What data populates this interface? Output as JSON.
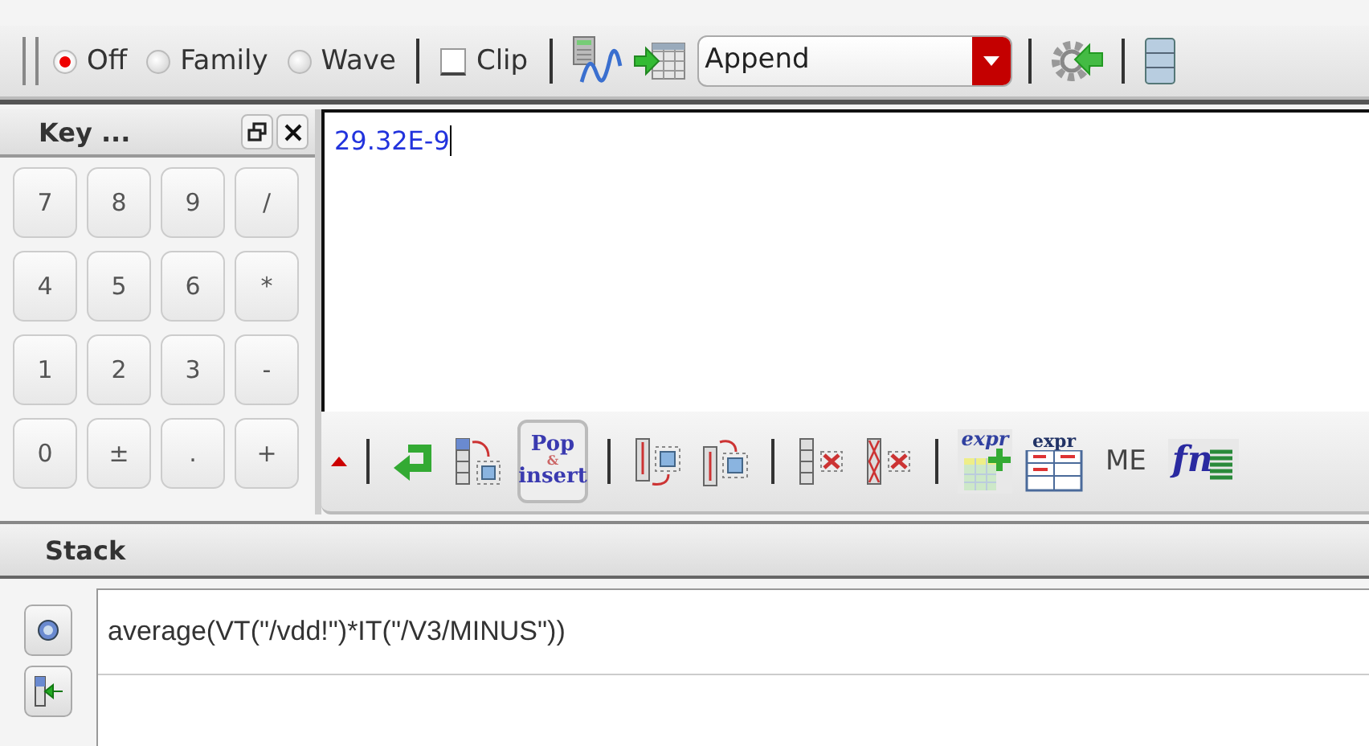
{
  "toolbar": {
    "radios": [
      {
        "label": "Off",
        "selected": true
      },
      {
        "label": "Family",
        "selected": false
      },
      {
        "label": "Wave",
        "selected": false
      }
    ],
    "clip": {
      "label": "Clip",
      "checked": false
    },
    "mode_dropdown": {
      "value": "Append"
    }
  },
  "keypad": {
    "title": "Key ...",
    "keys": [
      "7",
      "8",
      "9",
      "/",
      "4",
      "5",
      "6",
      "*",
      "1",
      "2",
      "3",
      "-",
      "0",
      "±",
      ".",
      "+"
    ]
  },
  "display": {
    "value": "29.32E-9"
  },
  "buffer_toolbar": {
    "pop_insert": [
      "Pop",
      "&",
      "insert"
    ],
    "expr_labels": [
      "expr",
      "expr"
    ],
    "me_label": "ME",
    "fn_label": "fn"
  },
  "stack": {
    "title": "Stack",
    "rows": [
      {
        "expression": "average(VT(\"/vdd!\")*IT(\"/V3/MINUS\"))"
      }
    ]
  }
}
